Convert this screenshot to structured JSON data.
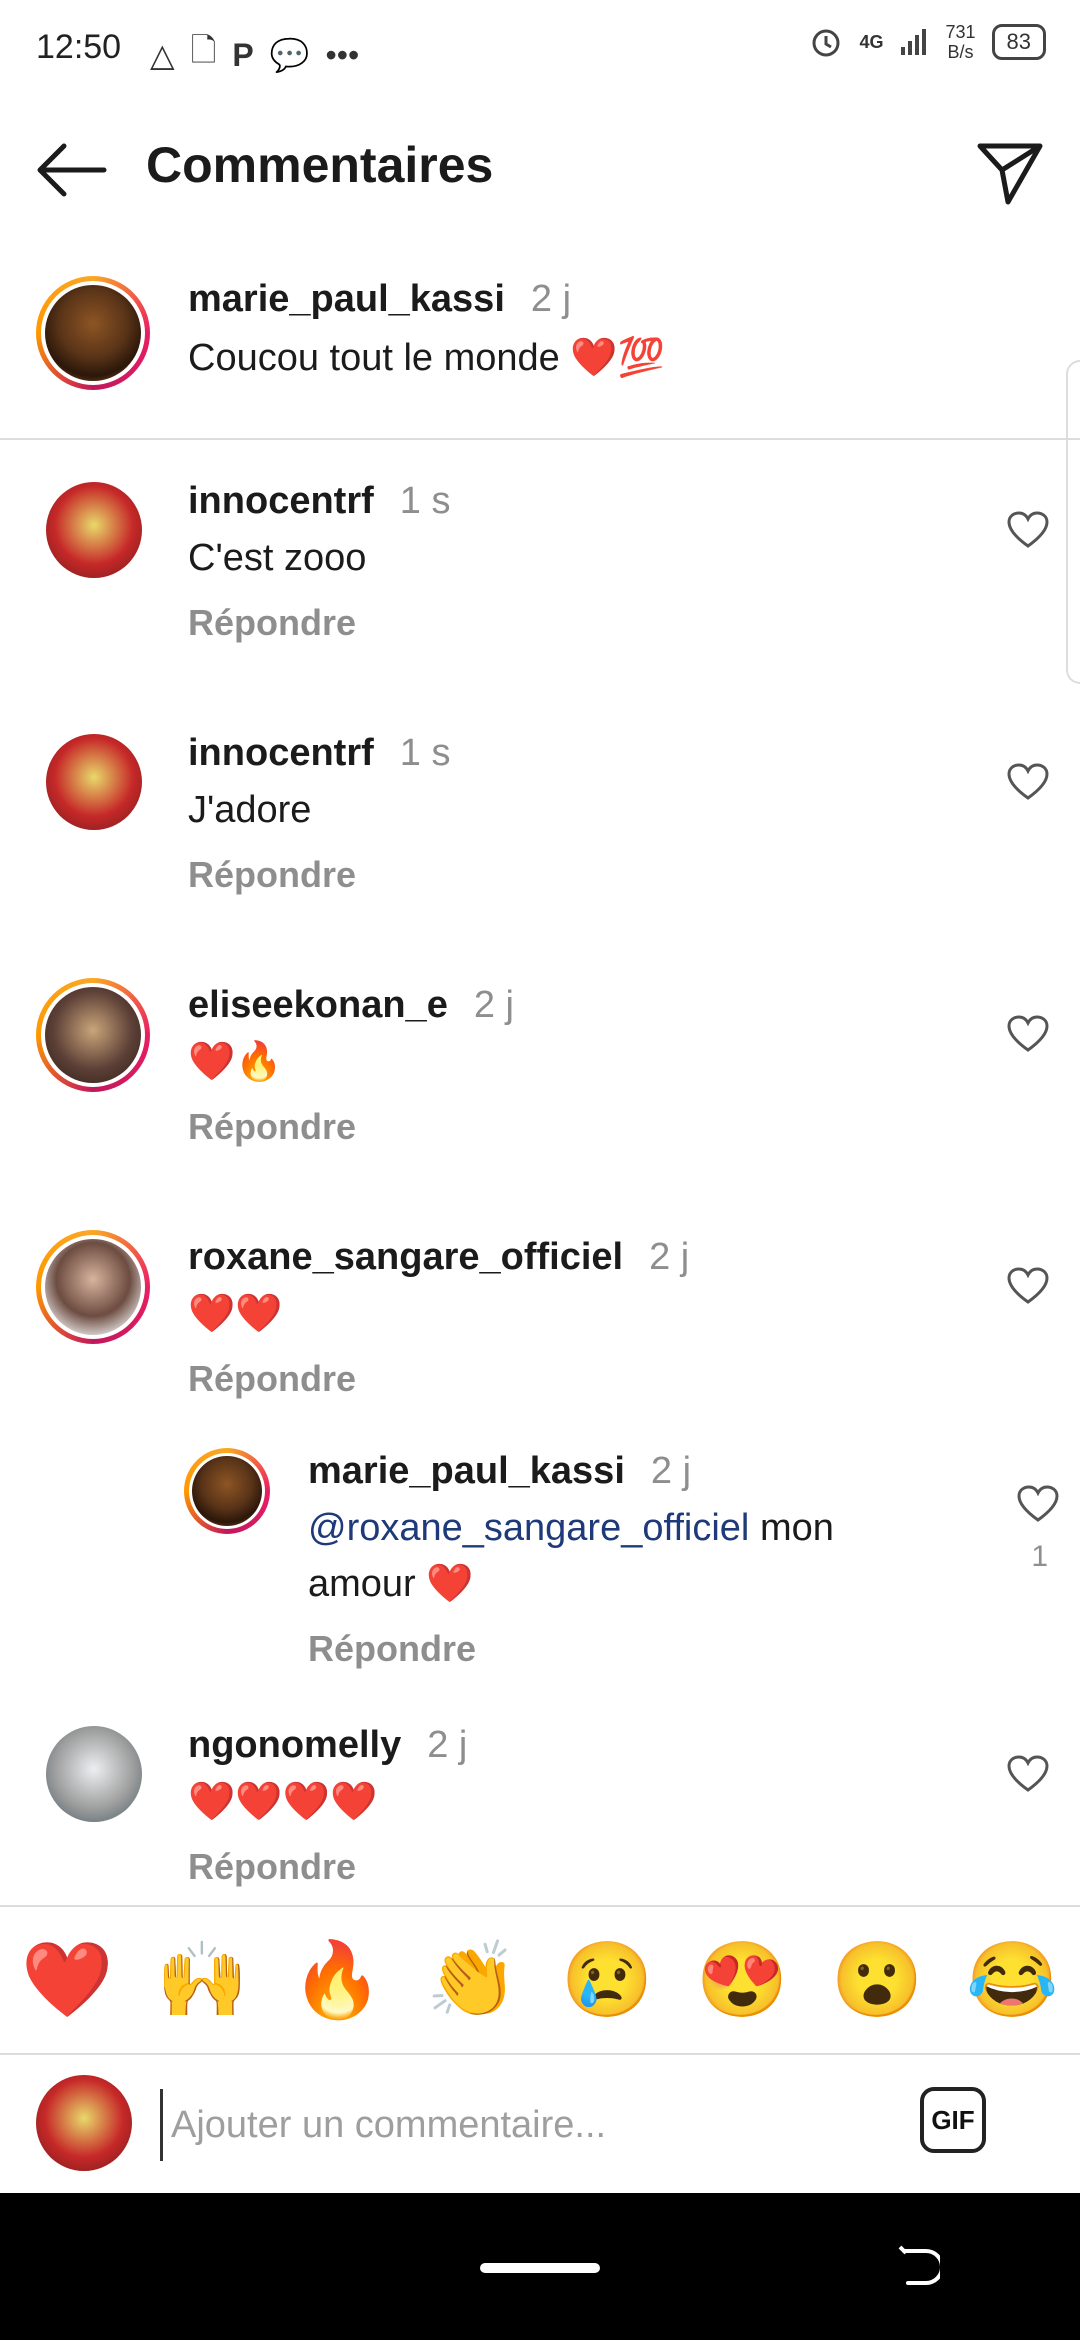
{
  "status_bar": {
    "time": "12:50",
    "left_icons": [
      "△",
      "🗋",
      "P",
      "💬",
      "•••"
    ],
    "network_label": "4G",
    "speed_value": "731",
    "speed_unit": "B/s",
    "battery": "83"
  },
  "header": {
    "title": "Commentaires"
  },
  "caption": {
    "username": "marie_paul_kassi",
    "time": "2 j",
    "text": "Coucou tout le monde ❤️💯"
  },
  "comments": [
    {
      "username": "innocentrf",
      "time": "1 s",
      "text": "C'est zooo",
      "reply_label": "Répondre"
    },
    {
      "username": "innocentrf",
      "time": "1 s",
      "text": "J'adore",
      "reply_label": "Répondre"
    },
    {
      "username": "eliseekonan_e",
      "time": "2 j",
      "text": "❤️🔥",
      "reply_label": "Répondre"
    },
    {
      "username": "roxane_sangare_officiel",
      "time": "2 j",
      "text": "❤️❤️",
      "reply_label": "Répondre"
    },
    {
      "username": "ngonomelly",
      "time": "2 j",
      "text": "❤️❤️❤️❤️",
      "reply_label": "Répondre"
    }
  ],
  "nested_reply": {
    "username": "marie_paul_kassi",
    "time": "2 j",
    "mention": "@roxane_sangare_officiel",
    "text_line1": " mon",
    "text_line2": "amour ❤️",
    "likes": "1",
    "reply_label": "Répondre"
  },
  "emoji_bar": [
    "❤️",
    "🙌",
    "🔥",
    "👏",
    "😢",
    "😍",
    "😮",
    "😂"
  ],
  "input": {
    "placeholder": "Ajouter un commentaire...",
    "gif_label": "GIF"
  },
  "colors": {
    "accent_ring": "#e91e63",
    "secondary_text": "#8e8e8e",
    "mention": "#1f3a7a"
  }
}
